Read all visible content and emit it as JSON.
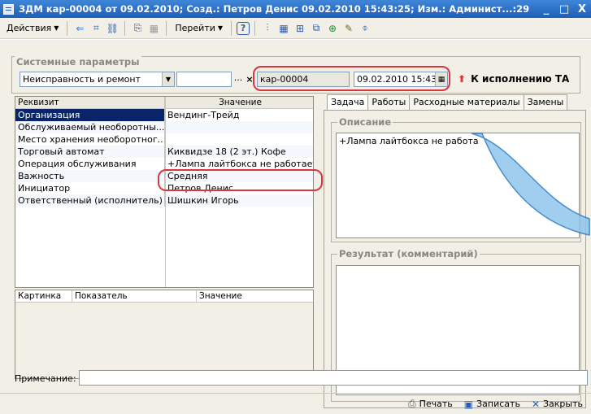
{
  "window": {
    "title": "ЗДМ кар-00004 от 09.02.2010; Созд.: Петров Денис 09.02.2010 15:43:25; Изм.: Админист...:29",
    "minimize": "_",
    "maximize": "□",
    "close": "X"
  },
  "toolbar": {
    "actions_label": "Действия",
    "goto_label": "Перейти",
    "help_label": "?"
  },
  "system_params": {
    "legend": "Системные параметры",
    "kind_value": "Неисправность и ремонт",
    "extra_value": "",
    "ellipsis": "...",
    "clear": "×",
    "number_value": "кар-00004",
    "date_value": "09.02.2010 15:43",
    "status_text": "К исполнению ТА",
    "status_color": "#d9363e"
  },
  "attributes": {
    "headers": [
      "Реквизит",
      "Значение"
    ],
    "rows": [
      {
        "name": "Организация",
        "value": "Вендинг-Трейд"
      },
      {
        "name": "Обслуживаемый необоротны...",
        "value": ""
      },
      {
        "name": "Место хранения необоротног...",
        "value": ""
      },
      {
        "name": "Торговый автомат",
        "value": "Киквидзе 18 (2 эт.) Кофе"
      },
      {
        "name": "Операция обслуживания",
        "value": "+Лампа лайтбокса не работает"
      },
      {
        "name": "Важность",
        "value": "Средняя"
      },
      {
        "name": "Инициатор",
        "value": "Петров Денис"
      },
      {
        "name": "Ответственный (исполнитель)",
        "value": "Шишкин Игорь"
      }
    ]
  },
  "pictures": {
    "headers": [
      "Картинка",
      "Показатель",
      "Значение"
    ]
  },
  "tabs": [
    "Задача",
    "Работы",
    "Расходные материалы",
    "Замены"
  ],
  "task": {
    "description_legend": "Описание",
    "description_text": "+Лампа лайтбокса не работа",
    "result_legend": "Результат (комментарий)",
    "result_text": ""
  },
  "note": {
    "label": "Примечание:",
    "value": ""
  },
  "buttons": {
    "print": "Печать",
    "save": "Записать",
    "close": "Закрыть"
  },
  "colors": {
    "title_bar": "#1e5fb8",
    "selection": "#0a246a",
    "highlight_oval": "#d9363e"
  }
}
